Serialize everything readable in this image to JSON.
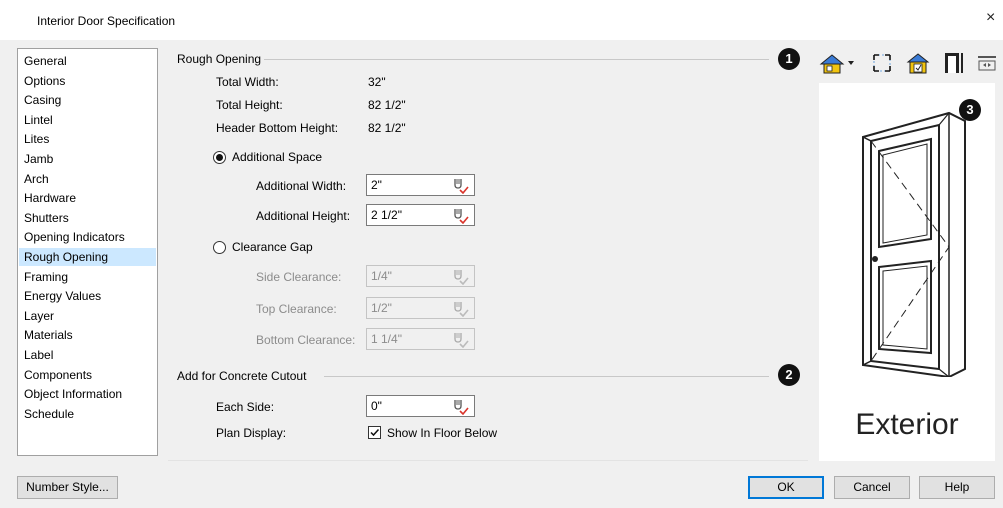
{
  "window": {
    "title": "Interior Door Specification",
    "close_glyph": "×"
  },
  "sidebar": {
    "selected_index": 10,
    "items": [
      {
        "label": "General"
      },
      {
        "label": "Options"
      },
      {
        "label": "Casing"
      },
      {
        "label": "Lintel"
      },
      {
        "label": "Lites"
      },
      {
        "label": "Jamb"
      },
      {
        "label": "Arch"
      },
      {
        "label": "Hardware"
      },
      {
        "label": "Shutters"
      },
      {
        "label": "Opening Indicators"
      },
      {
        "label": "Rough Opening"
      },
      {
        "label": "Framing"
      },
      {
        "label": "Energy Values"
      },
      {
        "label": "Layer"
      },
      {
        "label": "Materials"
      },
      {
        "label": "Label"
      },
      {
        "label": "Components"
      },
      {
        "label": "Object Information"
      },
      {
        "label": "Schedule"
      }
    ]
  },
  "rough_opening": {
    "title": "Rough Opening",
    "total_width_label": "Total Width:",
    "total_width_value": "32\"",
    "total_height_label": "Total Height:",
    "total_height_value": "82 1/2\"",
    "header_bottom_label": "Header Bottom Height:",
    "header_bottom_value": "82 1/2\"",
    "additional_space_label": "Additional Space",
    "additional_space_selected": true,
    "additional_width_label": "Additional Width:",
    "additional_width_value": "2\"",
    "additional_height_label": "Additional Height:",
    "additional_height_value": "2 1/2\"",
    "clearance_gap_label": "Clearance Gap",
    "clearance_gap_selected": false,
    "side_clearance_label": "Side Clearance:",
    "side_clearance_value": "1/4\"",
    "top_clearance_label": "Top Clearance:",
    "top_clearance_value": "1/2\"",
    "bottom_clearance_label": "Bottom Clearance:",
    "bottom_clearance_value": "1 1/4\""
  },
  "concrete_cutout": {
    "title": "Add for Concrete Cutout",
    "each_side_label": "Each Side:",
    "each_side_value": "0\"",
    "plan_display_label": "Plan Display:",
    "show_in_floor_below_label": "Show In Floor Below",
    "show_in_floor_below_checked": true
  },
  "callouts": {
    "one": "1",
    "two": "2",
    "three": "3"
  },
  "preview": {
    "label": "Exterior"
  },
  "buttons": {
    "number_style": "Number Style...",
    "ok": "OK",
    "cancel": "Cancel",
    "help": "Help"
  },
  "colors": {
    "selection": "#cce8ff",
    "default_button_border": "#0078d7",
    "fx_icon": "#d9342b",
    "check": "#111111"
  }
}
